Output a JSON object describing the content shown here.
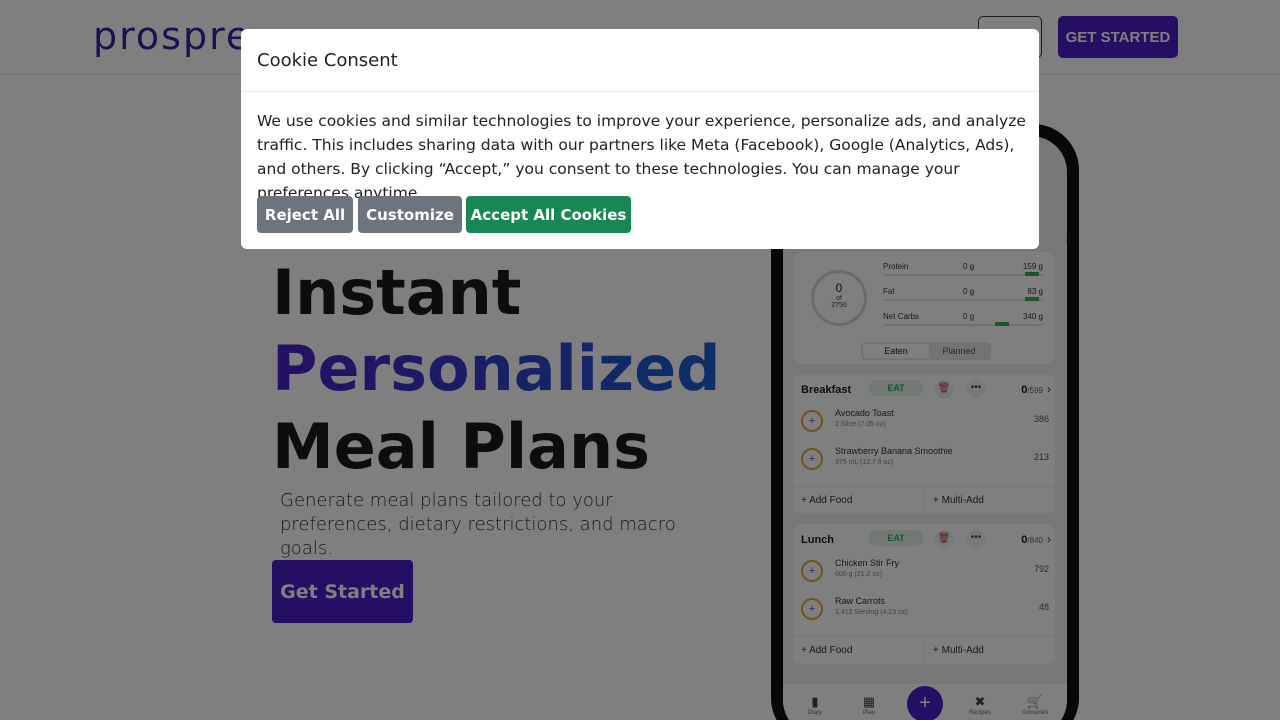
{
  "header": {
    "logo_text": "prospre",
    "login_label": "",
    "get_started_label": "GET STARTED"
  },
  "hero": {
    "line1": "Instant",
    "line2": "Personalized",
    "line3": "Meal Plans",
    "subtitle": "Generate meal plans tailored to your preferences, dietary restrictions, and macro goals.",
    "cta_label": "Get Started"
  },
  "phone": {
    "calories": {
      "eaten": "0",
      "of": "of",
      "goal": "2750"
    },
    "macros": [
      {
        "name": "Protein",
        "value": "0 g",
        "goal": "159 g"
      },
      {
        "name": "Fat",
        "value": "0 g",
        "goal": "83 g"
      },
      {
        "name": "Net Carbs",
        "value": "0 g",
        "goal": "340 g"
      }
    ],
    "toggle": {
      "eaten": "Eaten",
      "planned": "Planned"
    },
    "meals": [
      {
        "name": "Breakfast",
        "eat_label": "EAT",
        "cal_eaten": "0",
        "cal_goal": "/599",
        "foods": [
          {
            "name": "Avocado Toast",
            "serving": "2 Slice (7.05 oz)",
            "cal": "386"
          },
          {
            "name": "Strawberry Banana Smoothie",
            "serving": "375 mL (12.7 fl oz)",
            "cal": "213"
          }
        ],
        "add_food": "+ Add Food",
        "multi_add": "+ Multi-Add"
      },
      {
        "name": "Lunch",
        "eat_label": "EAT",
        "cal_eaten": "0",
        "cal_goal": "/840",
        "foods": [
          {
            "name": "Chicken Stir Fry",
            "serving": "600 g (21.2 oz)",
            "cal": "792"
          },
          {
            "name": "Raw Carrots",
            "serving": "1.412 Serving (4.23 oz)",
            "cal": "48"
          }
        ],
        "add_food": "+ Add Food",
        "multi_add": "+ Multi-Add"
      }
    ],
    "tabs": {
      "diary": "Diary",
      "plan": "Plan",
      "recipes": "Recipes",
      "groceries": "Groceries"
    }
  },
  "cookie_modal": {
    "title": "Cookie Consent",
    "body": "We use cookies and similar technologies to improve your experience, personalize ads, and analyze traffic. This includes sharing data with our partners like Meta (Facebook), Google (Analytics, Ads), and others. By clicking “Accept,” you consent to these technologies. You can manage your preferences anytime.",
    "reject_label": "Reject All",
    "customize_label": "Customize",
    "accept_label": "Accept All Cookies"
  },
  "colors": {
    "brand": "#4a1fc8",
    "accept_green": "#198754",
    "secondary_gray": "#6c757d"
  }
}
